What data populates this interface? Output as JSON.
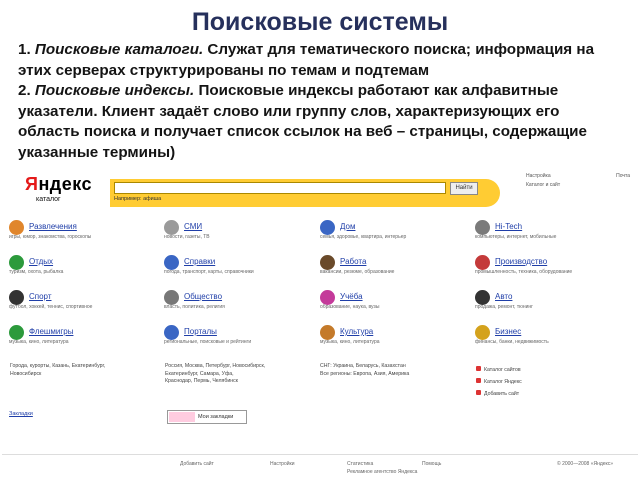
{
  "slide": {
    "title": "Поисковые системы",
    "p1_number": "1. ",
    "p1_term": "Поисковые каталоги.",
    "p1_text": " Служат для тематического поиска; информация на этих серверах структурированы по темам и подтемам",
    "p2_number": "2. ",
    "p2_term": "Поисковые индексы.",
    "p2_text": " Поисковые индексы работают как алфавитные указатели. Клиент задаёт слово или группу слов, характеризующих его область поиска и получает список ссылок на веб – страницы, содержащие указанные термины)"
  },
  "screenshot": {
    "logo_first": "Я",
    "logo_rest": "ндекс",
    "logo_sub": "каталог",
    "search_button": "Найти",
    "example": "Например: афиша",
    "right_left": "Настройка",
    "right_right": "Почта",
    "right_under": "Каталог и сайт",
    "categories": [
      {
        "name": "Развлечения",
        "sub": "игры, юмор, знакомства, гороскопы",
        "icon": "entertainment-icon",
        "color": "#e0862c"
      },
      {
        "name": "СМИ",
        "sub": "новости, газеты, ТВ",
        "icon": "media-icon",
        "color": "#9a9a9a"
      },
      {
        "name": "Дом",
        "sub": "семья, здоровье, квартира, интерьер",
        "icon": "home-icon",
        "color": "#3a66c4"
      },
      {
        "name": "Hi-Tech",
        "sub": "компьютеры, интернет, мобильные",
        "icon": "hitech-icon",
        "color": "#7a7a7a"
      },
      {
        "name": "Отдых",
        "sub": "туризм, охота, рыбалка",
        "icon": "leisure-icon",
        "color": "#2c9a3c"
      },
      {
        "name": "Справки",
        "sub": "погода, транспорт, карты, справочники",
        "icon": "reference-icon",
        "color": "#3a66c4"
      },
      {
        "name": "Работа",
        "sub": "вакансии, резюме, образование",
        "icon": "work-icon",
        "color": "#6a4a2a"
      },
      {
        "name": "Производство",
        "sub": "промышленность, техника, оборудование",
        "icon": "production-icon",
        "color": "#c43a3a"
      },
      {
        "name": "Спорт",
        "sub": "футбол, хоккей, теннис, спортивное",
        "icon": "sport-icon",
        "color": "#333333"
      },
      {
        "name": "Общество",
        "sub": "власть, политика, религия",
        "icon": "society-icon",
        "color": "#777777"
      },
      {
        "name": "Учёба",
        "sub": "образование, наука, вузы",
        "icon": "study-icon",
        "color": "#c43a9a"
      },
      {
        "name": "Авто",
        "sub": "продажа, ремонт, тюнинг",
        "icon": "auto-icon",
        "color": "#333333"
      },
      {
        "name": "Флешмигры",
        "sub": "музыка, кино, литература",
        "icon": "flash-icon",
        "color": "#2c9a3c"
      },
      {
        "name": "Порталы",
        "sub": "региональные, поисковые и рейтинги",
        "icon": "portals-icon",
        "color": "#3a66c4"
      },
      {
        "name": "Культура",
        "sub": "музыка, кино, литература",
        "icon": "culture-icon",
        "color": "#c47a2a"
      },
      {
        "name": "Бизнес",
        "sub": "финансы, банки, недвижимость",
        "icon": "business-icon",
        "color": "#d4a21c"
      }
    ],
    "regions": {
      "col1": [
        "Города, курорты, Казань, Екатеринбург,",
        "Новосибирск"
      ],
      "col2": [
        "Россия, Москва, Петербург, Новосибирск,",
        "Екатеринбург, Самара, Уфа,",
        "Краснодар, Пермь, Челябинск"
      ],
      "col3": [
        "СНГ: Украина, Беларусь, Казахстан",
        "Все регионы: Европа, Азия, Америка"
      ]
    },
    "promo": [
      "Каталог сайтов",
      "Каталог Яндекс",
      "Добавить сайт"
    ],
    "bookmark": "Закладки",
    "selbox_text": "Мои закладки",
    "footer": [
      "Добавить сайт",
      "Настройки",
      "Статистика",
      "Помощь",
      "© 2000—2008 «Яндекс»"
    ],
    "footer2": "Рекламное агентство Яндекса"
  }
}
